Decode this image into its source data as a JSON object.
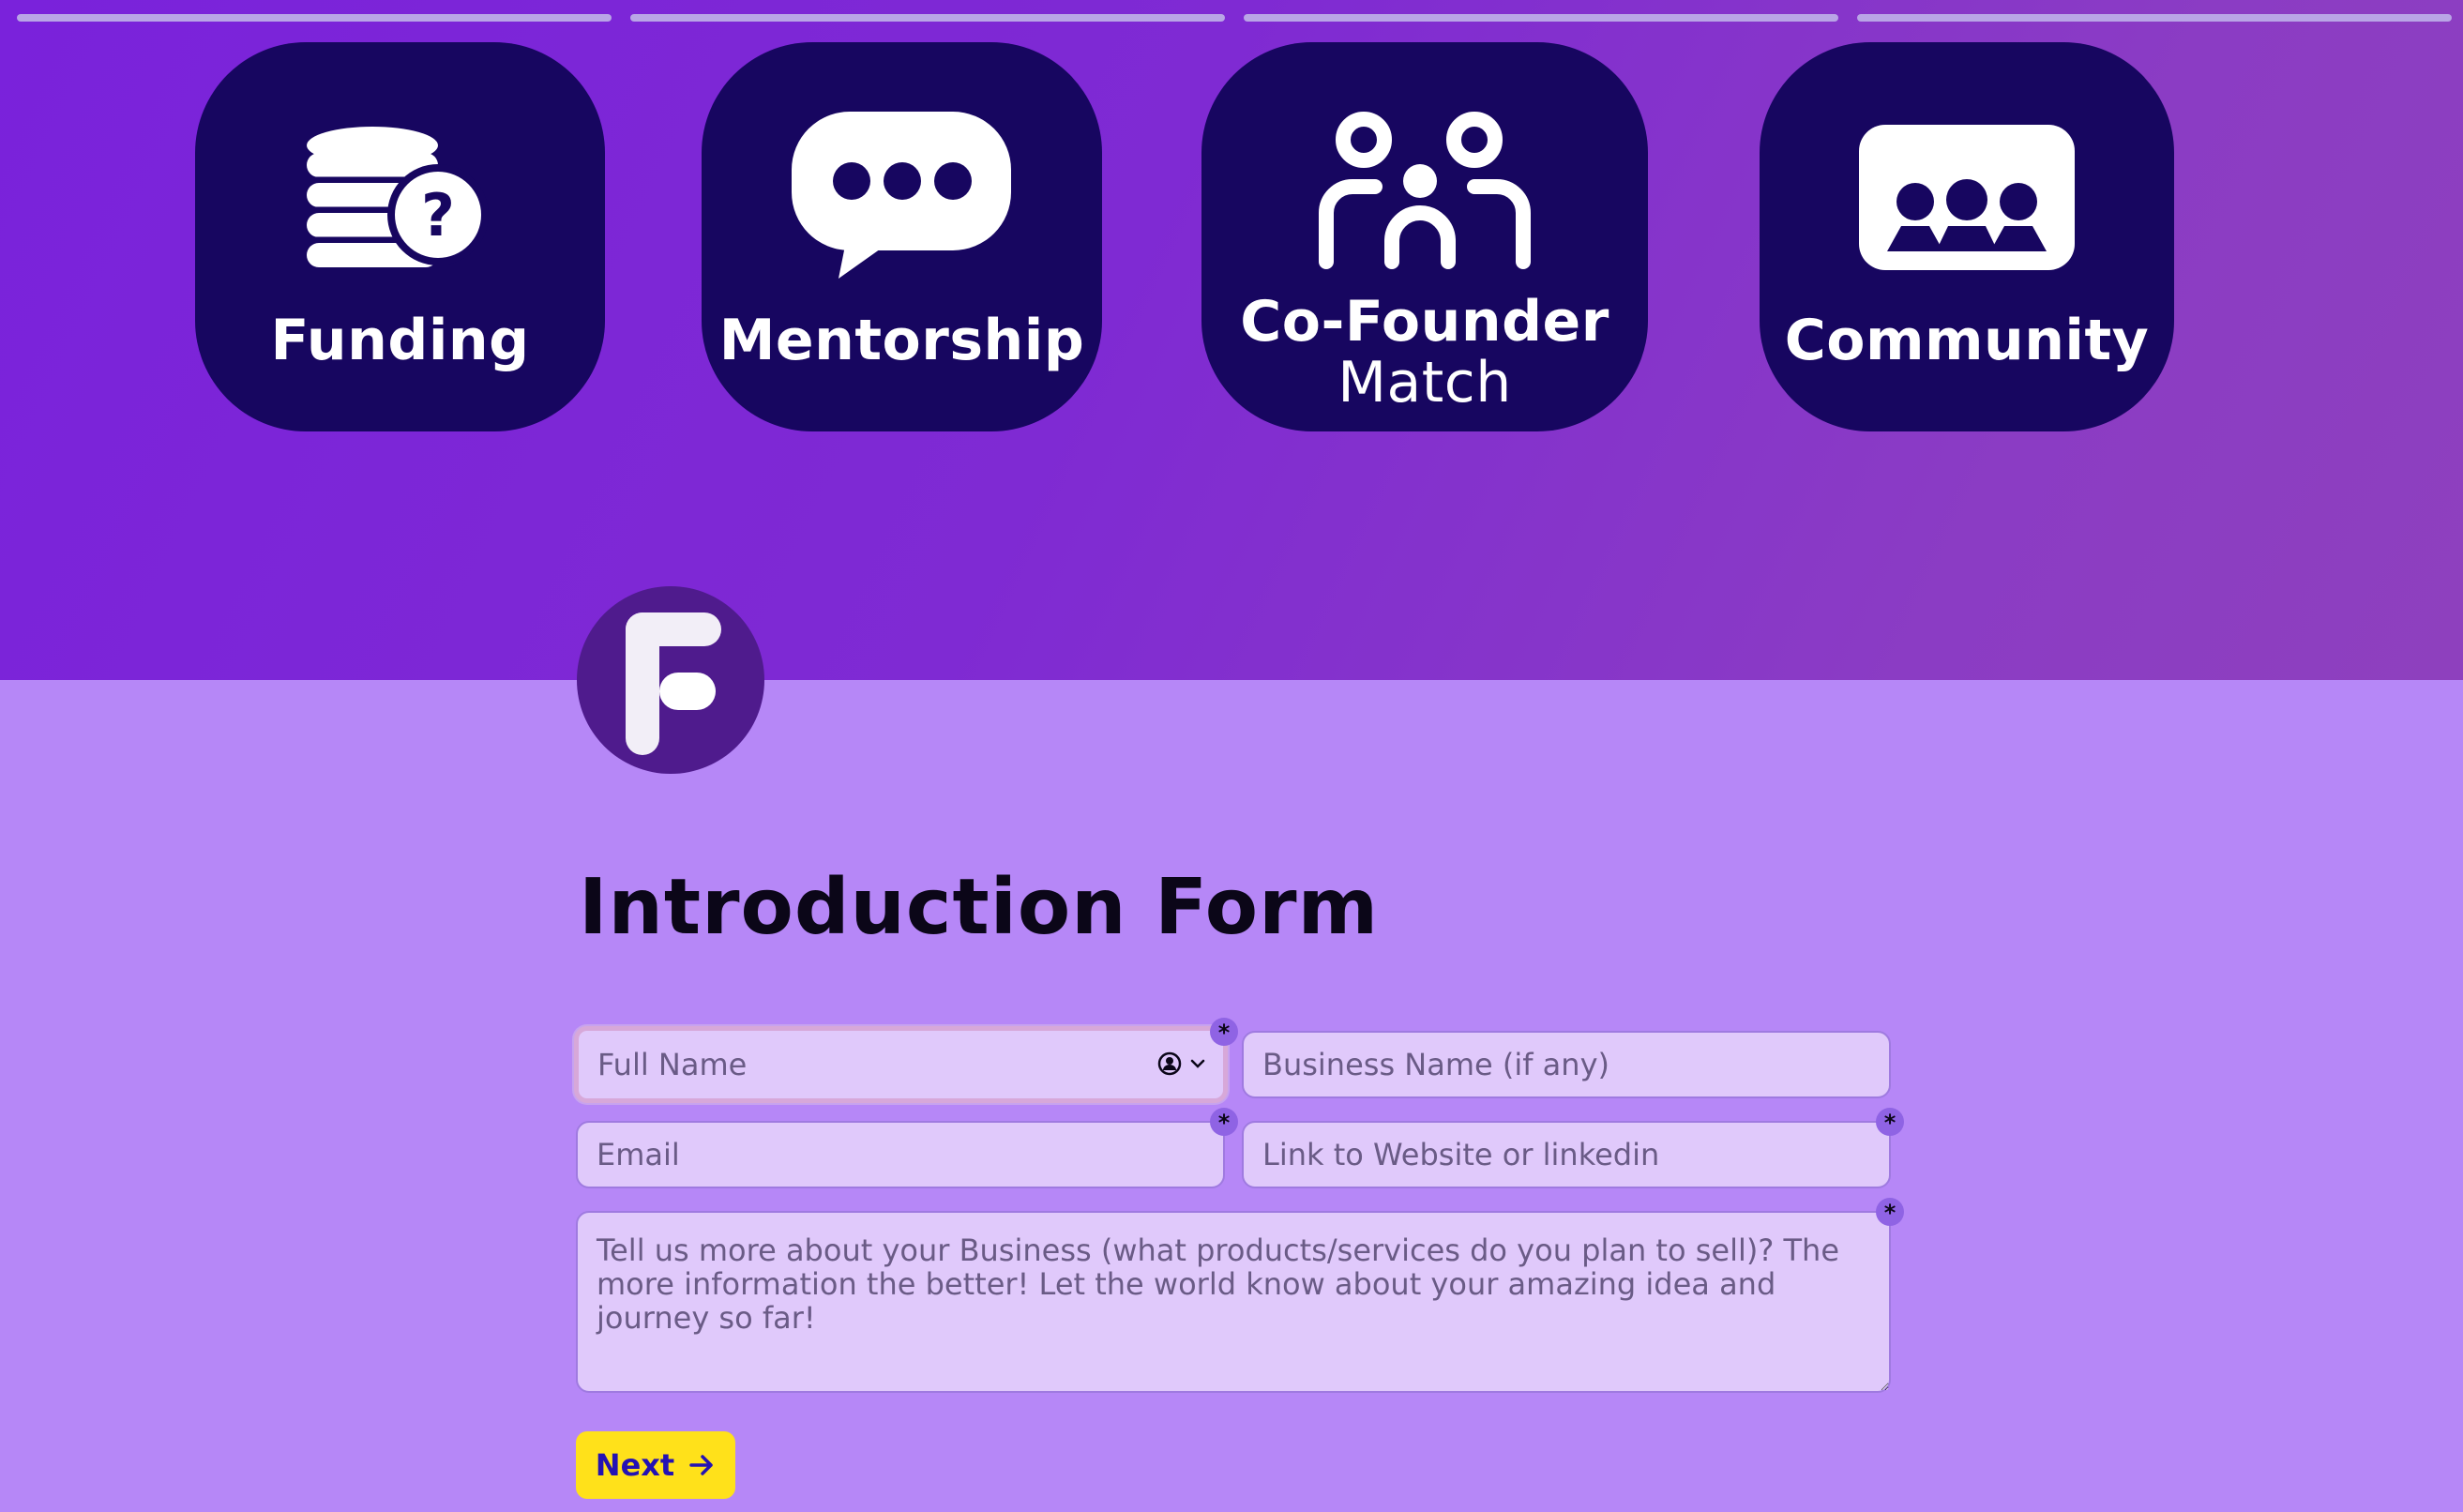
{
  "progress": {
    "total_steps": 4,
    "current_step": 1
  },
  "tiles": [
    {
      "label": "Funding",
      "icon": "coins-question-icon"
    },
    {
      "label": "Mentorship",
      "icon": "chat-bubble-icon"
    },
    {
      "label": "Co-Founder",
      "sublabel": "Match",
      "icon": "people-connect-icon"
    },
    {
      "label": "Community",
      "icon": "group-icon"
    }
  ],
  "logo": {
    "letter": "F"
  },
  "form": {
    "title": "Introduction Form",
    "full_name_placeholder": "Full Name",
    "business_name_placeholder": "Business Name (if any)",
    "email_placeholder": "Email",
    "website_placeholder": "Link to Website or linkedin",
    "business_description_placeholder": "Tell us more about your Business (what products/services do you plan to sell)? The more information the better! Let the world know about your amazing idea and journey so far!",
    "required_marker": "*",
    "next_label": "Next"
  },
  "colors": {
    "hero_start": "#7a22db",
    "hero_end": "#8e40be",
    "tile_bg": "#170660",
    "page_bg": "#b687f7",
    "field_bg": "#e0c9fb",
    "button_bg": "#ffe11a",
    "button_text": "#2412b3"
  }
}
